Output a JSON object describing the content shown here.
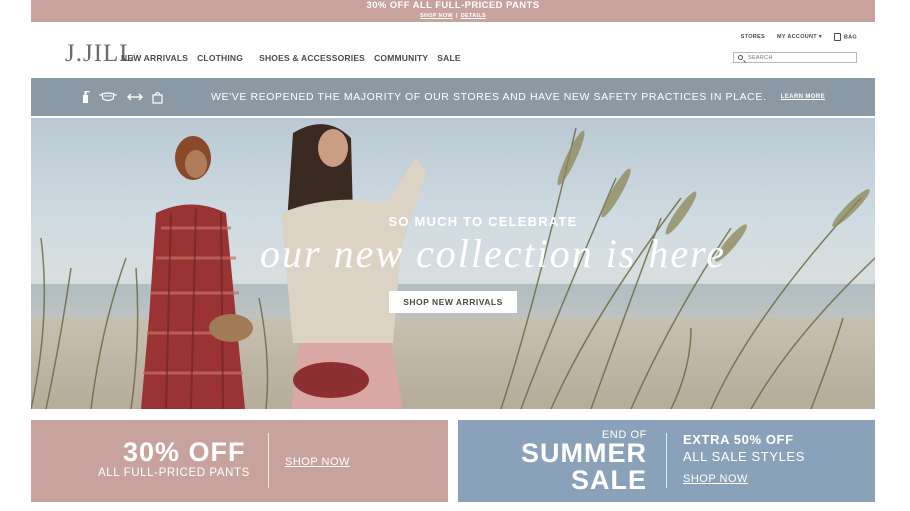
{
  "promo": {
    "title": "30% OFF ALL FULL-PRICED PANTS",
    "shop_now": "SHOP NOW",
    "separator": "|",
    "details": "DETAILS"
  },
  "header": {
    "logo": "J.JILL",
    "nav": [
      "NEW ARRIVALS",
      "CLOTHING",
      "SHOES & ACCESSORIES",
      "COMMUNITY",
      "SALE"
    ],
    "stores": "STORES",
    "my_account": "MY ACCOUNT",
    "bag": "BAG",
    "search_placeholder": "SEARCH"
  },
  "safety": {
    "icons": [
      "sanitizer-icon",
      "mask-icon",
      "distance-icon",
      "bag-icon"
    ],
    "message": "WE'VE REOPENED THE MAJORITY OF OUR STORES AND HAVE NEW SAFETY PRACTICES IN PLACE.",
    "learn_more": "LEARN MORE"
  },
  "hero": {
    "kicker": "SO MUCH TO CELEBRATE",
    "headline": "our new collection is here",
    "cta": "SHOP NEW ARRIVALS"
  },
  "banner_left": {
    "headline": "30% OFF",
    "subline": "ALL FULL-PRICED PANTS",
    "link": "SHOP NOW"
  },
  "banner_right": {
    "eyebrow": "END OF",
    "title_line1": "SUMMER",
    "title_line2": "SALE",
    "extra_line1": "EXTRA 50% OFF",
    "extra_line2": "ALL SALE STYLES",
    "link": "SHOP NOW"
  },
  "colors": {
    "promo_bg": "#c8a29d",
    "safety_bg": "#8a99a4",
    "right_banner_bg": "#8aa1ba"
  }
}
